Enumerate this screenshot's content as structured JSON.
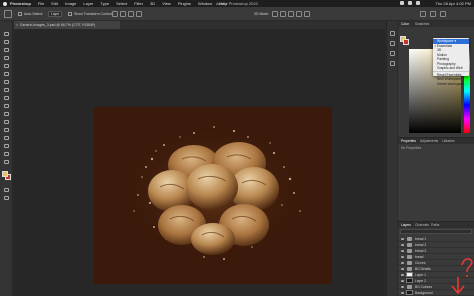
{
  "app": {
    "window_title": "Adobe Photoshop 2020",
    "clock": "Thu 28 Apr 4:02 PM"
  },
  "menu": [
    {
      "label": "Photoshop",
      "bold": true
    },
    {
      "label": "File"
    },
    {
      "label": "Edit"
    },
    {
      "label": "Image"
    },
    {
      "label": "Layer"
    },
    {
      "label": "Type"
    },
    {
      "label": "Select"
    },
    {
      "label": "Filter"
    },
    {
      "label": "3D"
    },
    {
      "label": "View"
    },
    {
      "label": "Plugins"
    },
    {
      "label": "Window"
    },
    {
      "label": "Help"
    }
  ],
  "options": {
    "auto_select_label": "Auto-Select:",
    "auto_select_value": "Layer",
    "show_transform_label": "Show Transform Controls",
    "mode_label": "3D Mode:"
  },
  "document": {
    "tab_title": "Generic-Images_3.psd @ 66.7% (CTIT, RGB/8*)"
  },
  "panels": {
    "color_tabs": [
      "Color",
      "Swatches"
    ],
    "properties_tabs": [
      "Properties",
      "Adjustments",
      "Libraries"
    ],
    "properties_note": "No Properties",
    "layers_tabs": [
      "Layers",
      "Channels",
      "Paths"
    ]
  },
  "workspace_menu": {
    "items": [
      {
        "label": "Workspace ▾",
        "selected": true
      },
      {
        "label": "Essentials",
        "checked": true
      },
      {
        "label": "3D"
      },
      {
        "label": "Motion"
      },
      {
        "label": "Painting"
      },
      {
        "label": "Photography"
      },
      {
        "label": "Graphic and Web"
      },
      {
        "label": "sep"
      },
      {
        "label": "Reset Essentials"
      },
      {
        "label": "New Workspace..."
      },
      {
        "label": "Delete Workspace..."
      }
    ]
  },
  "layers": [
    {
      "name": "bread 1",
      "type": "folder"
    },
    {
      "name": "bread 2",
      "type": "folder"
    },
    {
      "name": "bread 3",
      "type": "folder"
    },
    {
      "name": "bread",
      "type": "folder"
    },
    {
      "name": "Curves",
      "type": "folder"
    },
    {
      "name": "BG Details",
      "type": "folder"
    },
    {
      "name": "Layer 1",
      "type": "white"
    },
    {
      "name": "Layer 2",
      "type": "dark"
    },
    {
      "name": "BG Colours",
      "type": "folder"
    },
    {
      "name": "Background",
      "type": "dark"
    }
  ],
  "colors": {
    "foreground": "#e8c26a",
    "background": "#c0392b",
    "canvas_bg": "#3b1a0b",
    "accent": "#2d6fd6",
    "annotation": "#e53935"
  }
}
